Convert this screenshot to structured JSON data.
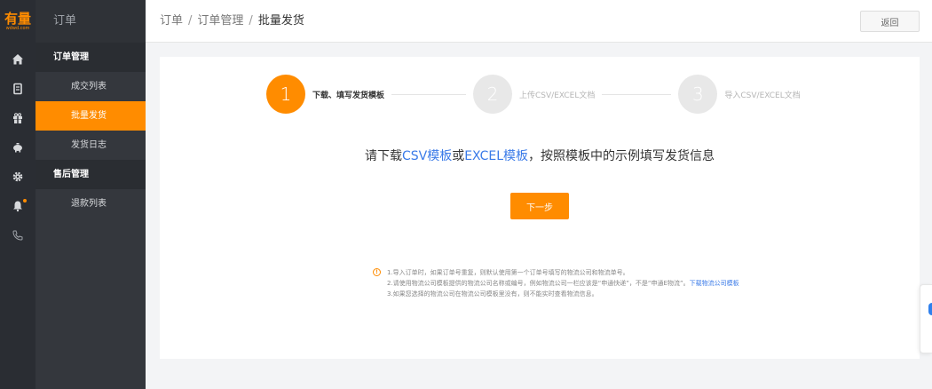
{
  "brand": {
    "logo_main": "有量",
    "logo_sub": "wdwd.com",
    "accent": "#ff8c00"
  },
  "sidebar": {
    "title": "订单",
    "groups": [
      {
        "label": "订单管理",
        "items": [
          {
            "label": "成交列表"
          },
          {
            "label": "批量发货",
            "active": true
          },
          {
            "label": "发货日志"
          }
        ]
      },
      {
        "label": "售后管理",
        "items": [
          {
            "label": "退款列表"
          }
        ]
      }
    ]
  },
  "rail_icons": [
    "home-icon",
    "order-icon",
    "gift-icon",
    "piggy-bank-icon",
    "gear-icon",
    "bell-icon",
    "phone-icon"
  ],
  "header": {
    "breadcrumb": [
      "订单",
      "订单管理",
      "批量发货"
    ],
    "separator": "/",
    "back_label": "返回"
  },
  "steps": [
    {
      "num": "1",
      "label": "下载、填写发货模板",
      "active": true
    },
    {
      "num": "2",
      "label": "上传CSV/EXCEL文档",
      "active": false
    },
    {
      "num": "3",
      "label": "导入CSV/EXCEL文档",
      "active": false
    }
  ],
  "instruction": {
    "prefix": "请下载",
    "csv_link": "CSV模板",
    "or": "或",
    "excel_link": "EXCEL模板",
    "suffix": "，按照模板中的示例填写发货信息"
  },
  "next_label": "下一步",
  "notes": {
    "icon": "!",
    "line1": "1.导入订单时，如果订单号重复，则默认使用第一个订单号填写的物流公司和物流单号。",
    "line2": "2.请使用物流公司模板提供的物流公司名称或编号，例如物流公司一栏应该是“申通快递”，不是“申通E物流”。",
    "line2_link": "下载物流公司模板",
    "line3": "3.如果您选择的物流公司在物流公司模板里没有，则不能实时查看物流信息。"
  }
}
